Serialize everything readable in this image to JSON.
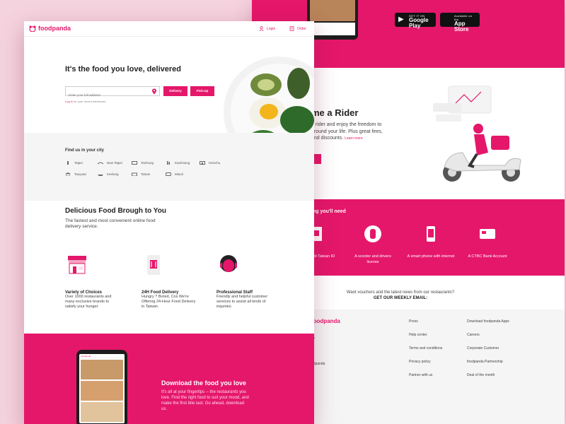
{
  "colors": {
    "brand": "#e5176b",
    "background": "#f5d3de"
  },
  "nav": {
    "logo": "foodpanda",
    "login": "Login",
    "order": "Order"
  },
  "hero": {
    "title": "It's the food you love, delivered",
    "address_placeholder": "Enter your full address",
    "delivery_btn": "Delivery",
    "pickup_btn": "Pick-Up",
    "login_note_link": "Log in",
    "login_note_rest": " for your recent addresses"
  },
  "cities": {
    "title": "Find us in your city",
    "items": [
      "Taipei",
      "New Taipei",
      "Taichung",
      "Kaohsiung",
      "Hsinchu",
      "Taoyuan",
      "Keelung",
      "Tainan",
      "Miaoli"
    ]
  },
  "delivery": {
    "title": "Delicious Food Brough to You",
    "subtitle": "The fastest and most convenient online food delivery service.",
    "features": [
      {
        "icon": "storefront-icon",
        "title": "Variety of Choices",
        "desc": "Over 1000 restaurants and many exclusive brands to satisfy your hunger."
      },
      {
        "icon": "food-bag-icon",
        "title": "24H Food Delivery",
        "desc": "Hungry ? Bored, Cos We're Offering 24-Hour Food Delivery in Taiwan."
      },
      {
        "icon": "staff-icon",
        "title": "Professional  Staff",
        "desc": "Friendly and helpful customer services to assist all kinds of inquiries."
      }
    ]
  },
  "download": {
    "title": "Download the food you love",
    "desc": "It's all at your fingertips -- the restaurants you love. Find the right food to suit your mood, and make the first bite last. Go ahead, download us.",
    "phone_header": "foodpanda"
  },
  "stores": {
    "google": {
      "top": "GET IT ON",
      "name": "Google Play"
    },
    "apple": {
      "top": "Available on the",
      "name": "App Store"
    }
  },
  "rider": {
    "title": "me a Rider",
    "desc": "a rider and enjoy the freedom to around your life. Plus great fees, and discounts.",
    "learn_more": "Learn more"
  },
  "needs": {
    "title": "ing you'll need",
    "items": [
      {
        "label": "0 years old Taiwan ID",
        "icon": "id-card-icon"
      },
      {
        "label": "A scooter and drivers license",
        "icon": "scooter-icon"
      },
      {
        "label": "A smart phone with internet",
        "icon": "smartphone-icon"
      },
      {
        "label": "A CTBC Bank Account",
        "icon": "bank-card-icon"
      }
    ]
  },
  "newsletter": {
    "question": "Want vouchers and the latest news from our restaurants?",
    "cta": "GET OUR WEEKLY EMAIL:"
  },
  "footer": {
    "brand": "foodpanda",
    "left_col": [
      "ity",
      "odpanda"
    ],
    "col2": [
      "Press",
      "Help center",
      "Terms and conditions",
      "Privacy policy",
      "Partner with us"
    ],
    "col3": [
      "Download foodpanda Apps",
      "Careers",
      "Corporate Customer",
      "foodpanda Partnership",
      "Deal of the month"
    ]
  }
}
